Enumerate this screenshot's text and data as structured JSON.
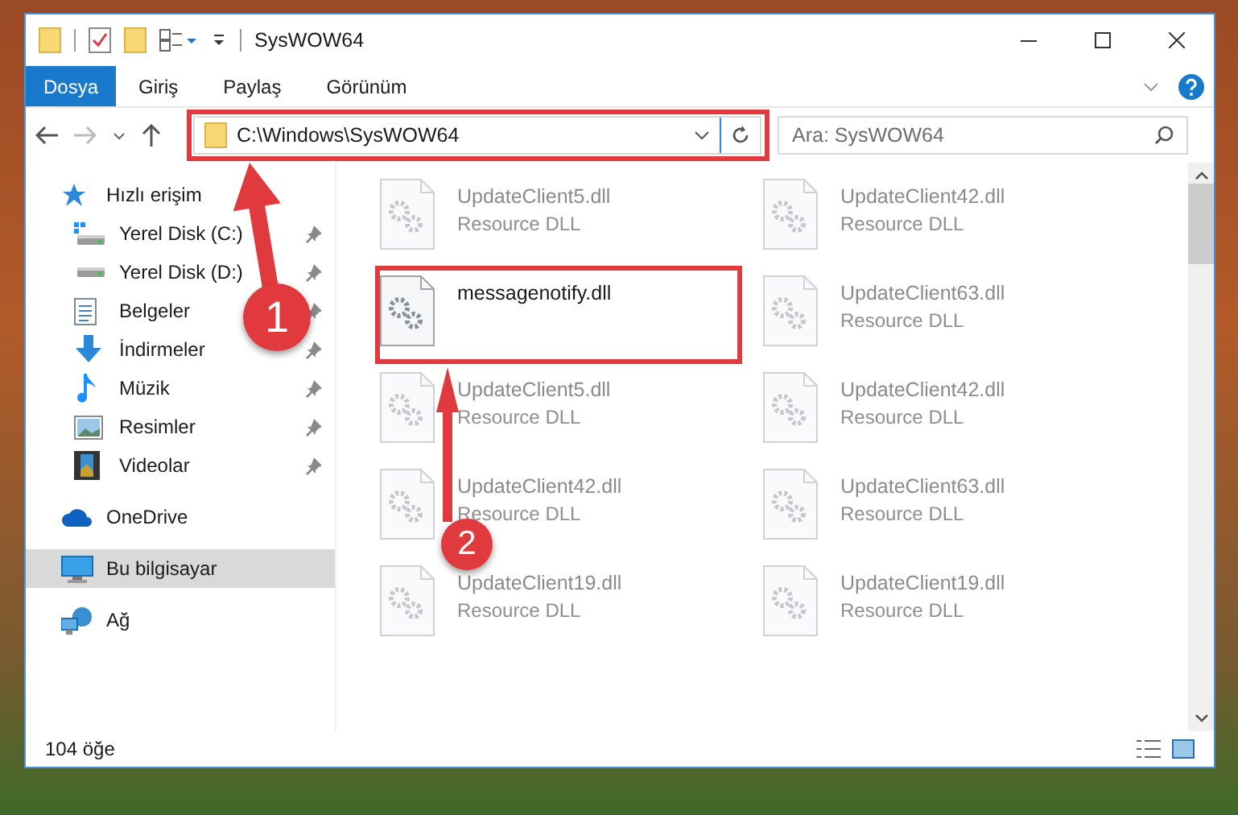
{
  "window": {
    "title": "SysWOW64"
  },
  "ribbon_tabs": [
    {
      "label": "Dosya",
      "kind": "file"
    },
    {
      "label": "Giriş",
      "kind": "tab"
    },
    {
      "label": "Paylaş",
      "kind": "tab"
    },
    {
      "label": "Görünüm",
      "kind": "tab"
    }
  ],
  "address": {
    "path": "C:\\Windows\\SysWOW64"
  },
  "search": {
    "placeholder": "Ara: SysWOW64"
  },
  "nav": [
    {
      "label": "Hızlı erişim",
      "kind": "star",
      "selected": false,
      "children": [
        {
          "label": "Yerel Disk (C:)",
          "kind": "drive-c",
          "pinned": true,
          "selected": false
        },
        {
          "label": "Yerel Disk (D:)",
          "kind": "drive",
          "pinned": true,
          "selected": false
        },
        {
          "label": "Belgeler",
          "kind": "documents",
          "pinned": true,
          "selected": false
        },
        {
          "label": "İndirmeler",
          "kind": "downloads",
          "pinned": true,
          "selected": false
        },
        {
          "label": "Müzik",
          "kind": "music",
          "pinned": true,
          "selected": false
        },
        {
          "label": "Resimler",
          "kind": "pictures",
          "pinned": true,
          "selected": false
        },
        {
          "label": "Videolar",
          "kind": "videos",
          "pinned": true,
          "selected": false
        }
      ]
    },
    {
      "label": "OneDrive",
      "kind": "cloud",
      "selected": false
    },
    {
      "label": "Bu bilgisayar",
      "kind": "computer",
      "selected": true
    },
    {
      "label": "Ağ",
      "kind": "network",
      "selected": false
    }
  ],
  "files": [
    {
      "name": "UpdateClient5.dll",
      "type": "Resource DLL",
      "blurred": true
    },
    {
      "name": "UpdateClient42.dll",
      "type": "Resource DLL",
      "blurred": true
    },
    {
      "name": "messagenotify.dll",
      "blurred": false
    },
    {
      "name": "UpdateClient63.dll",
      "type": "Resource DLL",
      "blurred": true
    },
    {
      "name": "UpdateClient5.dll",
      "type": "Resource DLL",
      "blurred": true
    },
    {
      "name": "UpdateClient42.dll",
      "type": "Resource DLL",
      "blurred": true
    },
    {
      "name": "UpdateClient42.dll",
      "type": "Resource DLL",
      "blurred": true
    },
    {
      "name": "UpdateClient63.dll",
      "type": "Resource DLL",
      "blurred": true
    },
    {
      "name": "UpdateClient19.dll",
      "type": "Resource DLL",
      "blurred": true
    },
    {
      "name": "UpdateClient19.dll",
      "type": "Resource DLL",
      "blurred": true
    }
  ],
  "status_bar": {
    "count": "104 öğe"
  },
  "annotations": [
    {
      "label": "1"
    },
    {
      "label": "2"
    }
  ]
}
